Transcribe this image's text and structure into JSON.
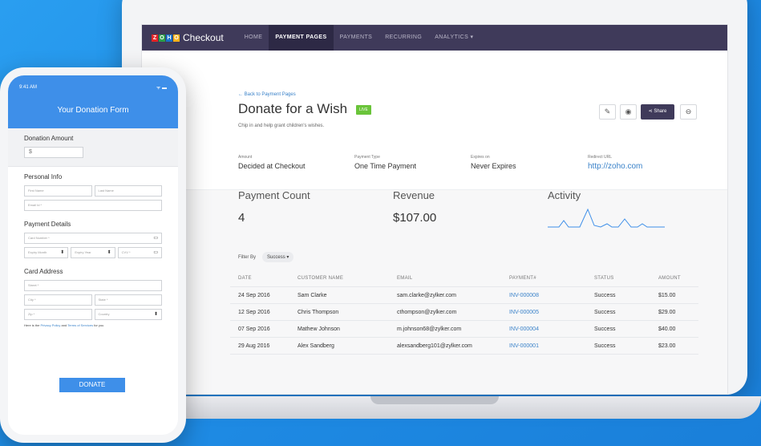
{
  "navbar": {
    "brand_logo": "ZOHO",
    "brand_name": "Checkout",
    "items": [
      {
        "label": "HOME"
      },
      {
        "label": "PAYMENT PAGES"
      },
      {
        "label": "PAYMENTS"
      },
      {
        "label": "RECURRING"
      },
      {
        "label": "ANALYTICS ▾"
      }
    ]
  },
  "page": {
    "back_link": "← Back to Payment Pages",
    "title": "Donate for a Wish",
    "badge": "LIVE",
    "subtitle": "Chip in and help grant children's wishes.",
    "share_label": "Share"
  },
  "meta": [
    {
      "label": "Amount",
      "value": "Decided at Checkout"
    },
    {
      "label": "Payment Type",
      "value": "One Time Payment"
    },
    {
      "label": "Expires on",
      "value": "Never Expires"
    },
    {
      "label": "Redirect URL",
      "value": "http://zoho.com"
    }
  ],
  "stats": {
    "count_label": "Payment Count",
    "count_value": "4",
    "revenue_label": "Revenue",
    "revenue_value": "$107.00",
    "activity_label": "Activity"
  },
  "filter": {
    "label": "Filter By",
    "value": "Success ▾"
  },
  "table": {
    "headers": [
      "DATE",
      "CUSTOMER NAME",
      "EMAIL",
      "PAYMENT#",
      "STATUS",
      "AMOUNT"
    ],
    "rows": [
      [
        "24 Sep 2016",
        "Sam Clarke",
        "sam.clarke@zylker.com",
        "INV-000008",
        "Success",
        "$15.00"
      ],
      [
        "12 Sep 2016",
        "Chris Thompson",
        "cthompson@zylker.com",
        "INV-000005",
        "Success",
        "$29.00"
      ],
      [
        "07 Sep 2016",
        "Mathew Johnson",
        "m.johnson68@zylker.com",
        "INV-000004",
        "Success",
        "$40.00"
      ],
      [
        "29 Aug 2016",
        "Alex Sandberg",
        "alexsandberg101@zylker.com",
        "INV-000001",
        "Success",
        "$23.00"
      ]
    ]
  },
  "phone": {
    "time": "9:41 AM",
    "form_title": "Your Donation Form",
    "donation_amount_label": "Donation Amount",
    "currency": "$",
    "personal_info_label": "Personal Info",
    "first_name": "First Name",
    "last_name": "Last Name",
    "email": "Email Id *",
    "payment_details_label": "Payment Details",
    "card_number": "Card Number *",
    "expiry_month": "Expiry Month",
    "expiry_year": "Expiry Year",
    "cvv": "CVV *",
    "card_address_label": "Card Address",
    "street": "Street *",
    "city": "City *",
    "state": "State *",
    "zip": "Zip *",
    "country": "Country",
    "policy_prefix": "Here is the",
    "policy_link": "Privacy Policy",
    "policy_and": "and",
    "terms_link": "Terms of Services",
    "policy_suffix": "for you",
    "donate_label": "DONATE"
  },
  "colors": {
    "nav_bg": "#3f3a5a",
    "accent_blue": "#3e8fe9",
    "live_green": "#6ac43a",
    "link_blue": "#3a82c9"
  }
}
